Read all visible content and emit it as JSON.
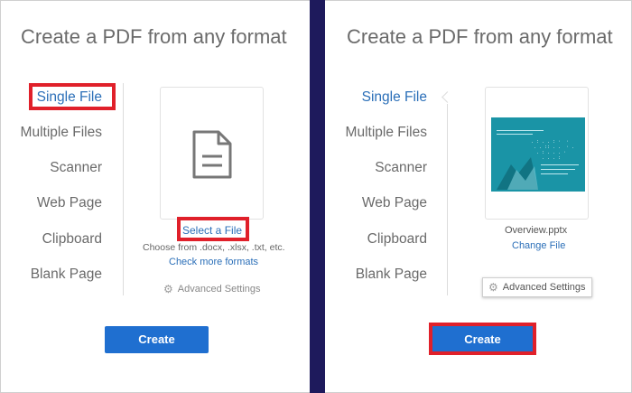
{
  "left_panel": {
    "title": "Create a PDF from any format",
    "nav": [
      "Single File",
      "Multiple Files",
      "Scanner",
      "Web Page",
      "Clipboard",
      "Blank Page"
    ],
    "select_file_label": "Select a File",
    "formats_hint": "Choose from .docx, .xlsx, .txt, etc.",
    "more_formats_link": "Check more formats",
    "advanced_settings": "Advanced Settings",
    "create_label": "Create"
  },
  "right_panel": {
    "title": "Create a PDF from any format",
    "nav": [
      "Single File",
      "Multiple Files",
      "Scanner",
      "Web Page",
      "Clipboard",
      "Blank Page"
    ],
    "file_name": "Overview.pptx",
    "change_file_link": "Change File",
    "advanced_settings": "Advanced Settings",
    "create_label": "Create"
  },
  "colors": {
    "accent": "#2b6fb8",
    "create_button": "#1f6fd0",
    "highlight_box": "#e0202a",
    "divider": "#1e1a5c",
    "thumbnail": "#1a94a6"
  },
  "icons": {
    "document": "document-icon",
    "gear": "gear-icon"
  }
}
